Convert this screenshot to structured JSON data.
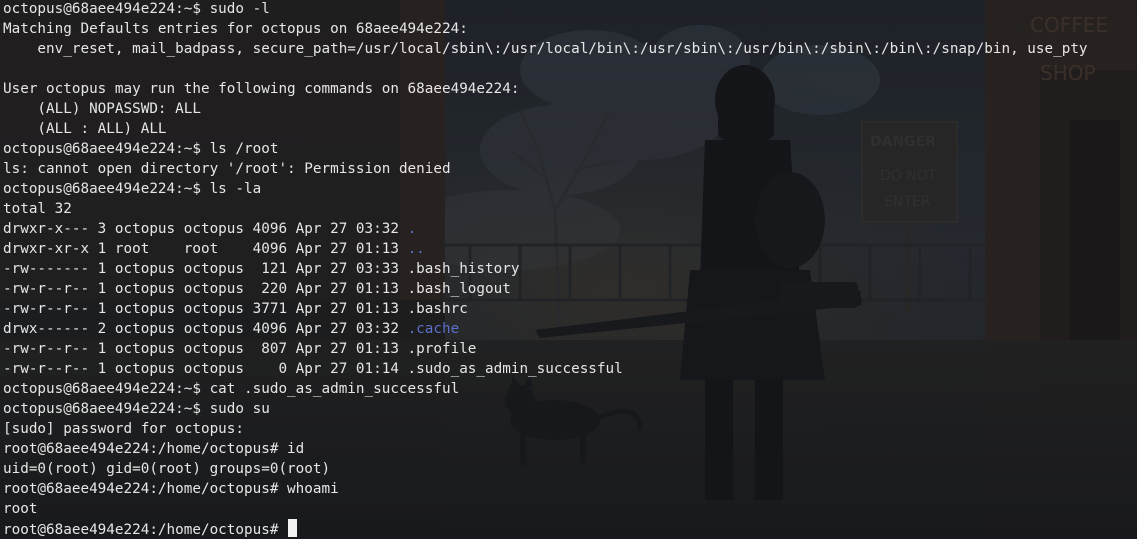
{
  "terminal": {
    "colors": {
      "text": "#e6e6e6",
      "directory": "#5b6fc9",
      "cursor": "#f2f2f2"
    },
    "lines": [
      [
        {
          "t": "octopus@68aee494e224:~$ sudo -l"
        }
      ],
      [
        {
          "t": "Matching Defaults entries for octopus on 68aee494e224:"
        }
      ],
      [
        {
          "t": "    env_reset, mail_badpass, secure_path=/usr/local/sbin\\:/usr/local/bin\\:/usr/sbin\\:/usr/bin\\:/sbin\\:/bin\\:/snap/bin, use_pty"
        }
      ],
      [
        {
          "t": ""
        }
      ],
      [
        {
          "t": "User octopus may run the following commands on 68aee494e224:"
        }
      ],
      [
        {
          "t": "    (ALL) NOPASSWD: ALL"
        }
      ],
      [
        {
          "t": "    (ALL : ALL) ALL"
        }
      ],
      [
        {
          "t": "octopus@68aee494e224:~$ ls /root"
        }
      ],
      [
        {
          "t": "ls: cannot open directory '/root': Permission denied"
        }
      ],
      [
        {
          "t": "octopus@68aee494e224:~$ ls -la"
        }
      ],
      [
        {
          "t": "total 32"
        }
      ],
      [
        {
          "t": "drwxr-x--- 3 octopus octopus 4096 Apr 27 03:32 "
        },
        {
          "t": ".",
          "c": "dir"
        }
      ],
      [
        {
          "t": "drwxr-xr-x 1 root    root    4096 Apr 27 01:13 "
        },
        {
          "t": "..",
          "c": "dir"
        }
      ],
      [
        {
          "t": "-rw------- 1 octopus octopus  121 Apr 27 03:33 .bash_history"
        }
      ],
      [
        {
          "t": "-rw-r--r-- 1 octopus octopus  220 Apr 27 01:13 .bash_logout"
        }
      ],
      [
        {
          "t": "-rw-r--r-- 1 octopus octopus 3771 Apr 27 01:13 .bashrc"
        }
      ],
      [
        {
          "t": "drwx------ 2 octopus octopus 4096 Apr 27 03:32 "
        },
        {
          "t": ".cache",
          "c": "dir"
        }
      ],
      [
        {
          "t": "-rw-r--r-- 1 octopus octopus  807 Apr 27 01:13 .profile"
        }
      ],
      [
        {
          "t": "-rw-r--r-- 1 octopus octopus    0 Apr 27 01:14 .sudo_as_admin_successful"
        }
      ],
      [
        {
          "t": "octopus@68aee494e224:~$ cat .sudo_as_admin_successful"
        }
      ],
      [
        {
          "t": "octopus@68aee494e224:~$ sudo su"
        }
      ],
      [
        {
          "t": "[sudo] password for octopus:"
        }
      ],
      [
        {
          "t": "root@68aee494e224:/home/octopus# id"
        }
      ],
      [
        {
          "t": "uid=0(root) gid=0(root) groups=0(root)"
        }
      ],
      [
        {
          "t": "root@68aee494e224:/home/octopus# whoami"
        }
      ],
      [
        {
          "t": "root"
        }
      ],
      [
        {
          "t": "root@68aee494e224:/home/octopus# "
        },
        {
          "t": "",
          "c": "cursor"
        }
      ]
    ]
  },
  "wallpaper": {
    "sign_danger": "DANGER",
    "sign_do_not": "DO NOT",
    "sign_enter": "ENTER",
    "shop_line1": "COFFEE",
    "shop_line2": "SHOP"
  }
}
